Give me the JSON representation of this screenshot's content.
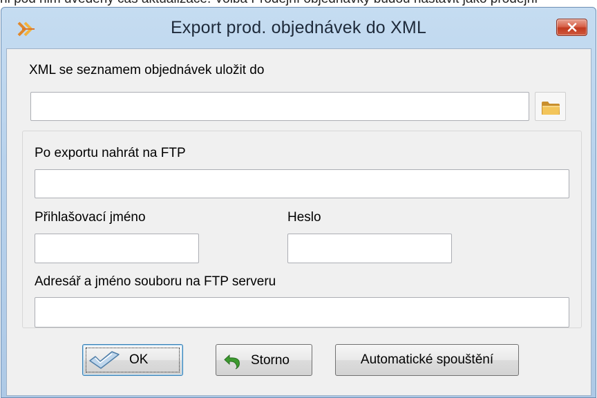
{
  "top_strip_text": "ni pod nim uvedený čas aktualizace. Volba Prodejní objednávky budou nastavit jako prodejní",
  "window": {
    "title": "Export prod. objednávek do XML",
    "icon": "double-arrow-app-icon",
    "close_icon": "close-icon"
  },
  "form": {
    "xml_path_label": "XML se seznamem objednávek uložit do",
    "xml_path_value": "",
    "browse_icon": "folder-icon",
    "ftp_label": "Po exportu nahrát na FTP",
    "ftp_value": "",
    "login_label": "Přihlašovací jméno",
    "login_value": "",
    "password_label": "Heslo",
    "password_value": "",
    "remote_path_label": "Adresář a jméno souboru na FTP serveru",
    "remote_path_value": ""
  },
  "buttons": {
    "ok_label": "OK",
    "storno_label": "Storno",
    "auto_label": "Automatické spouštění"
  },
  "colors": {
    "window_frame": "#b8d2ec",
    "client_bg": "#f0f0f0",
    "close_button": "#c13a1f",
    "ok_focus_border": "#3c7fb1"
  }
}
